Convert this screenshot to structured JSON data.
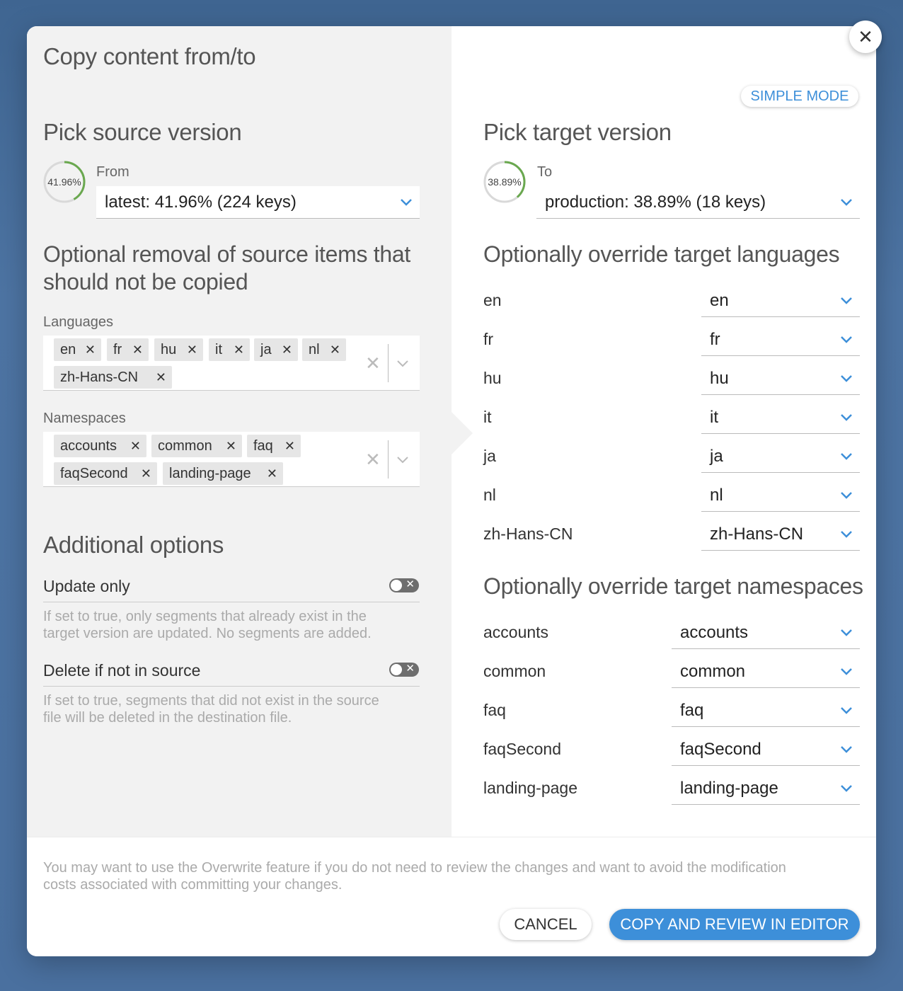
{
  "dialog": {
    "title": "Copy content from/to",
    "simple_mode_label": "SIMPLE MODE"
  },
  "source": {
    "heading": "Pick source version",
    "gauge_text": "41.96%",
    "gauge_fraction": 0.4196,
    "field_label": "From",
    "selected": "latest: 41.96% (224 keys)"
  },
  "removal": {
    "heading_line1": "Optional removal of source items that",
    "heading_line2": "should not be copied",
    "languages_label": "Languages",
    "languages": [
      "en",
      "fr",
      "hu",
      "it",
      "ja",
      "nl",
      "zh-Hans-CN"
    ],
    "namespaces_label": "Namespaces",
    "namespaces": [
      "accounts",
      "common",
      "faq",
      "faqSecond",
      "landing-page"
    ]
  },
  "options": {
    "heading": "Additional options",
    "update_only": {
      "label": "Update only",
      "enabled": false,
      "help_line1": "If set to true, only segments that already exist in the",
      "help_line2": "target version are updated. No segments are added."
    },
    "delete_if_not_in_source": {
      "label": "Delete if not in source",
      "enabled": false,
      "help_line1": "If set to true, segments that did not exist in the source",
      "help_line2": "file will be deleted in the destination file."
    }
  },
  "target": {
    "heading": "Pick target version",
    "gauge_text": "38.89%",
    "gauge_fraction": 0.3889,
    "field_label": "To",
    "selected": "production: 38.89% (18 keys)"
  },
  "override_languages": {
    "heading": "Optionally override target languages",
    "rows": [
      {
        "source": "en",
        "target": "en"
      },
      {
        "source": "fr",
        "target": "fr"
      },
      {
        "source": "hu",
        "target": "hu"
      },
      {
        "source": "it",
        "target": "it"
      },
      {
        "source": "ja",
        "target": "ja"
      },
      {
        "source": "nl",
        "target": "nl"
      },
      {
        "source": "zh-Hans-CN",
        "target": "zh-Hans-CN"
      }
    ]
  },
  "override_namespaces": {
    "heading": "Optionally override target namespaces",
    "rows": [
      {
        "source": "accounts",
        "target": "accounts"
      },
      {
        "source": "common",
        "target": "common"
      },
      {
        "source": "faq",
        "target": "faq"
      },
      {
        "source": "faqSecond",
        "target": "faqSecond"
      },
      {
        "source": "landing-page",
        "target": "landing-page"
      }
    ]
  },
  "footer": {
    "note_line1": "You may want to use the Overwrite feature if you do not need to review the changes and want to avoid the modification",
    "note_line2": "costs associated with committing your changes.",
    "cancel_label": "CANCEL",
    "copy_label": "COPY AND REVIEW IN EDITOR"
  },
  "colors": {
    "accent": "#3d8fd9",
    "gauge_green": "#6aa84f",
    "gauge_track": "#d9d9d9"
  },
  "icons": {
    "chevron": "chevron-down-icon",
    "remove": "x-icon",
    "close": "close-icon"
  }
}
